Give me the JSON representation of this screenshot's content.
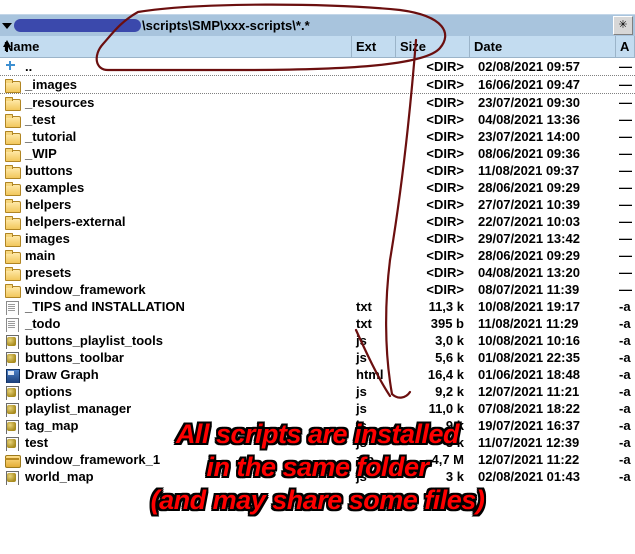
{
  "window": {
    "kind": "file-manager-listing"
  },
  "path_bar": {
    "dropdown_icon": "chevron-down-icon",
    "redacted": true,
    "path_text": "\\scripts\\SMP\\xxx-scripts\\*.*",
    "button_label": "✳"
  },
  "columns": {
    "name": "Name",
    "ext": "Ext",
    "size": "Size",
    "date": "Date",
    "attr": "A",
    "sort_indicator": "sort-ascending-icon"
  },
  "rows": [
    {
      "icon": "up-directory-icon",
      "name": "..",
      "ext": "",
      "size": "<DIR>",
      "date": "02/08/2021 09:57",
      "attr": "—",
      "sep": true
    },
    {
      "icon": "folder-icon",
      "name": "_images",
      "ext": "",
      "size": "<DIR>",
      "date": "16/06/2021 09:47",
      "attr": "—",
      "sep": true
    },
    {
      "icon": "folder-icon",
      "name": "_resources",
      "ext": "",
      "size": "<DIR>",
      "date": "23/07/2021 09:30",
      "attr": "—",
      "sep": false
    },
    {
      "icon": "folder-icon",
      "name": "_test",
      "ext": "",
      "size": "<DIR>",
      "date": "04/08/2021 13:36",
      "attr": "—",
      "sep": false
    },
    {
      "icon": "folder-icon",
      "name": "_tutorial",
      "ext": "",
      "size": "<DIR>",
      "date": "23/07/2021 14:00",
      "attr": "—",
      "sep": false
    },
    {
      "icon": "folder-icon",
      "name": "_WIP",
      "ext": "",
      "size": "<DIR>",
      "date": "08/06/2021 09:36",
      "attr": "—",
      "sep": false
    },
    {
      "icon": "folder-icon",
      "name": "buttons",
      "ext": "",
      "size": "<DIR>",
      "date": "11/08/2021 09:37",
      "attr": "—",
      "sep": false
    },
    {
      "icon": "folder-icon",
      "name": "examples",
      "ext": "",
      "size": "<DIR>",
      "date": "28/06/2021 09:29",
      "attr": "—",
      "sep": false
    },
    {
      "icon": "folder-icon",
      "name": "helpers",
      "ext": "",
      "size": "<DIR>",
      "date": "27/07/2021 10:39",
      "attr": "—",
      "sep": false
    },
    {
      "icon": "folder-icon",
      "name": "helpers-external",
      "ext": "",
      "size": "<DIR>",
      "date": "22/07/2021 10:03",
      "attr": "—",
      "sep": false
    },
    {
      "icon": "folder-icon",
      "name": "images",
      "ext": "",
      "size": "<DIR>",
      "date": "29/07/2021 13:42",
      "attr": "—",
      "sep": false
    },
    {
      "icon": "folder-icon",
      "name": "main",
      "ext": "",
      "size": "<DIR>",
      "date": "28/06/2021 09:29",
      "attr": "—",
      "sep": false
    },
    {
      "icon": "folder-icon",
      "name": "presets",
      "ext": "",
      "size": "<DIR>",
      "date": "04/08/2021 13:20",
      "attr": "—",
      "sep": false
    },
    {
      "icon": "folder-icon",
      "name": "window_framework",
      "ext": "",
      "size": "<DIR>",
      "date": "08/07/2021 11:39",
      "attr": "—",
      "sep": false
    },
    {
      "icon": "text-file-icon",
      "name": "_TIPS and INSTALLATION",
      "ext": "txt",
      "size": "11,3 k",
      "date": "10/08/2021 19:17",
      "attr": "-a",
      "sep": false
    },
    {
      "icon": "text-file-icon",
      "name": "_todo",
      "ext": "txt",
      "size": "395 b",
      "date": "11/08/2021 11:29",
      "attr": "-a",
      "sep": false
    },
    {
      "icon": "script-file-icon",
      "name": "buttons_playlist_tools",
      "ext": "js",
      "size": "3,0 k",
      "date": "10/08/2021 10:16",
      "attr": "-a",
      "sep": false
    },
    {
      "icon": "script-file-icon",
      "name": "buttons_toolbar",
      "ext": "js",
      "size": "5,6 k",
      "date": "01/08/2021 22:35",
      "attr": "-a",
      "sep": false
    },
    {
      "icon": "html-file-icon",
      "name": "Draw Graph",
      "ext": "html",
      "size": "16,4 k",
      "date": "01/06/2021 18:48",
      "attr": "-a",
      "sep": false
    },
    {
      "icon": "script-file-icon",
      "name": "options",
      "ext": "js",
      "size": "9,2 k",
      "date": "12/07/2021 11:21",
      "attr": "-a",
      "sep": false
    },
    {
      "icon": "script-file-icon",
      "name": "playlist_manager",
      "ext": "js",
      "size": "11,0 k",
      "date": "07/08/2021 18:22",
      "attr": "-a",
      "sep": false
    },
    {
      "icon": "script-file-icon",
      "name": "tag_map",
      "ext": "js",
      "size": "9 k",
      "date": "19/07/2021 16:37",
      "attr": "-a",
      "sep": false
    },
    {
      "icon": "script-file-icon",
      "name": "test",
      "ext": "js",
      "size": "3 k",
      "date": "11/07/2021 12:39",
      "attr": "-a",
      "sep": false
    },
    {
      "icon": "archive-file-icon",
      "name": "window_framework_1",
      "ext": "zip",
      "size": "4,7 M",
      "date": "12/07/2021 11:22",
      "attr": "-a",
      "sep": false
    },
    {
      "icon": "script-file-icon",
      "name": "world_map",
      "ext": "js",
      "size": "3 k",
      "date": "02/08/2021 01:43",
      "attr": "-a",
      "sep": false
    }
  ],
  "annotation": {
    "color": "#ff0000",
    "outline_color": "#000000",
    "arrow_color": "#6b0f0f",
    "line1": "All scripts are installed",
    "line2": "in the same folder",
    "line3": "(and may share some files)"
  }
}
